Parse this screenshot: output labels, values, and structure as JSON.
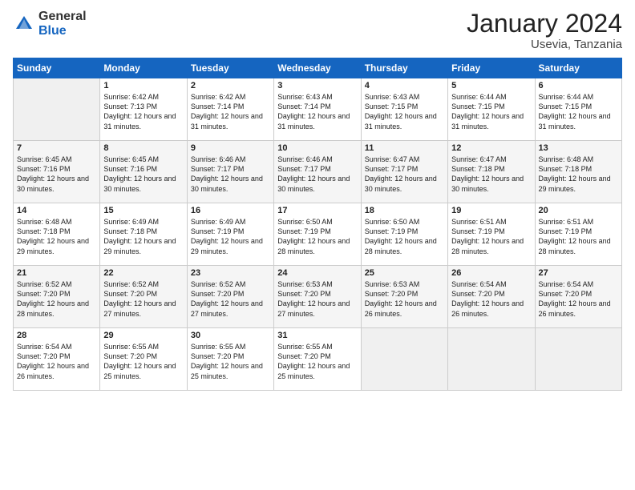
{
  "logo": {
    "general": "General",
    "blue": "Blue"
  },
  "title": "January 2024",
  "location": "Usevia, Tanzania",
  "days_header": [
    "Sunday",
    "Monday",
    "Tuesday",
    "Wednesday",
    "Thursday",
    "Friday",
    "Saturday"
  ],
  "weeks": [
    [
      {
        "day": "",
        "sunrise": "",
        "sunset": "",
        "daylight": ""
      },
      {
        "day": "1",
        "sunrise": "Sunrise: 6:42 AM",
        "sunset": "Sunset: 7:13 PM",
        "daylight": "Daylight: 12 hours and 31 minutes."
      },
      {
        "day": "2",
        "sunrise": "Sunrise: 6:42 AM",
        "sunset": "Sunset: 7:14 PM",
        "daylight": "Daylight: 12 hours and 31 minutes."
      },
      {
        "day": "3",
        "sunrise": "Sunrise: 6:43 AM",
        "sunset": "Sunset: 7:14 PM",
        "daylight": "Daylight: 12 hours and 31 minutes."
      },
      {
        "day": "4",
        "sunrise": "Sunrise: 6:43 AM",
        "sunset": "Sunset: 7:15 PM",
        "daylight": "Daylight: 12 hours and 31 minutes."
      },
      {
        "day": "5",
        "sunrise": "Sunrise: 6:44 AM",
        "sunset": "Sunset: 7:15 PM",
        "daylight": "Daylight: 12 hours and 31 minutes."
      },
      {
        "day": "6",
        "sunrise": "Sunrise: 6:44 AM",
        "sunset": "Sunset: 7:15 PM",
        "daylight": "Daylight: 12 hours and 31 minutes."
      }
    ],
    [
      {
        "day": "7",
        "sunrise": "Sunrise: 6:45 AM",
        "sunset": "Sunset: 7:16 PM",
        "daylight": "Daylight: 12 hours and 30 minutes."
      },
      {
        "day": "8",
        "sunrise": "Sunrise: 6:45 AM",
        "sunset": "Sunset: 7:16 PM",
        "daylight": "Daylight: 12 hours and 30 minutes."
      },
      {
        "day": "9",
        "sunrise": "Sunrise: 6:46 AM",
        "sunset": "Sunset: 7:17 PM",
        "daylight": "Daylight: 12 hours and 30 minutes."
      },
      {
        "day": "10",
        "sunrise": "Sunrise: 6:46 AM",
        "sunset": "Sunset: 7:17 PM",
        "daylight": "Daylight: 12 hours and 30 minutes."
      },
      {
        "day": "11",
        "sunrise": "Sunrise: 6:47 AM",
        "sunset": "Sunset: 7:17 PM",
        "daylight": "Daylight: 12 hours and 30 minutes."
      },
      {
        "day": "12",
        "sunrise": "Sunrise: 6:47 AM",
        "sunset": "Sunset: 7:18 PM",
        "daylight": "Daylight: 12 hours and 30 minutes."
      },
      {
        "day": "13",
        "sunrise": "Sunrise: 6:48 AM",
        "sunset": "Sunset: 7:18 PM",
        "daylight": "Daylight: 12 hours and 29 minutes."
      }
    ],
    [
      {
        "day": "14",
        "sunrise": "Sunrise: 6:48 AM",
        "sunset": "Sunset: 7:18 PM",
        "daylight": "Daylight: 12 hours and 29 minutes."
      },
      {
        "day": "15",
        "sunrise": "Sunrise: 6:49 AM",
        "sunset": "Sunset: 7:18 PM",
        "daylight": "Daylight: 12 hours and 29 minutes."
      },
      {
        "day": "16",
        "sunrise": "Sunrise: 6:49 AM",
        "sunset": "Sunset: 7:19 PM",
        "daylight": "Daylight: 12 hours and 29 minutes."
      },
      {
        "day": "17",
        "sunrise": "Sunrise: 6:50 AM",
        "sunset": "Sunset: 7:19 PM",
        "daylight": "Daylight: 12 hours and 28 minutes."
      },
      {
        "day": "18",
        "sunrise": "Sunrise: 6:50 AM",
        "sunset": "Sunset: 7:19 PM",
        "daylight": "Daylight: 12 hours and 28 minutes."
      },
      {
        "day": "19",
        "sunrise": "Sunrise: 6:51 AM",
        "sunset": "Sunset: 7:19 PM",
        "daylight": "Daylight: 12 hours and 28 minutes."
      },
      {
        "day": "20",
        "sunrise": "Sunrise: 6:51 AM",
        "sunset": "Sunset: 7:19 PM",
        "daylight": "Daylight: 12 hours and 28 minutes."
      }
    ],
    [
      {
        "day": "21",
        "sunrise": "Sunrise: 6:52 AM",
        "sunset": "Sunset: 7:20 PM",
        "daylight": "Daylight: 12 hours and 28 minutes."
      },
      {
        "day": "22",
        "sunrise": "Sunrise: 6:52 AM",
        "sunset": "Sunset: 7:20 PM",
        "daylight": "Daylight: 12 hours and 27 minutes."
      },
      {
        "day": "23",
        "sunrise": "Sunrise: 6:52 AM",
        "sunset": "Sunset: 7:20 PM",
        "daylight": "Daylight: 12 hours and 27 minutes."
      },
      {
        "day": "24",
        "sunrise": "Sunrise: 6:53 AM",
        "sunset": "Sunset: 7:20 PM",
        "daylight": "Daylight: 12 hours and 27 minutes."
      },
      {
        "day": "25",
        "sunrise": "Sunrise: 6:53 AM",
        "sunset": "Sunset: 7:20 PM",
        "daylight": "Daylight: 12 hours and 26 minutes."
      },
      {
        "day": "26",
        "sunrise": "Sunrise: 6:54 AM",
        "sunset": "Sunset: 7:20 PM",
        "daylight": "Daylight: 12 hours and 26 minutes."
      },
      {
        "day": "27",
        "sunrise": "Sunrise: 6:54 AM",
        "sunset": "Sunset: 7:20 PM",
        "daylight": "Daylight: 12 hours and 26 minutes."
      }
    ],
    [
      {
        "day": "28",
        "sunrise": "Sunrise: 6:54 AM",
        "sunset": "Sunset: 7:20 PM",
        "daylight": "Daylight: 12 hours and 26 minutes."
      },
      {
        "day": "29",
        "sunrise": "Sunrise: 6:55 AM",
        "sunset": "Sunset: 7:20 PM",
        "daylight": "Daylight: 12 hours and 25 minutes."
      },
      {
        "day": "30",
        "sunrise": "Sunrise: 6:55 AM",
        "sunset": "Sunset: 7:20 PM",
        "daylight": "Daylight: 12 hours and 25 minutes."
      },
      {
        "day": "31",
        "sunrise": "Sunrise: 6:55 AM",
        "sunset": "Sunset: 7:20 PM",
        "daylight": "Daylight: 12 hours and 25 minutes."
      },
      {
        "day": "",
        "sunrise": "",
        "sunset": "",
        "daylight": ""
      },
      {
        "day": "",
        "sunrise": "",
        "sunset": "",
        "daylight": ""
      },
      {
        "day": "",
        "sunrise": "",
        "sunset": "",
        "daylight": ""
      }
    ]
  ]
}
